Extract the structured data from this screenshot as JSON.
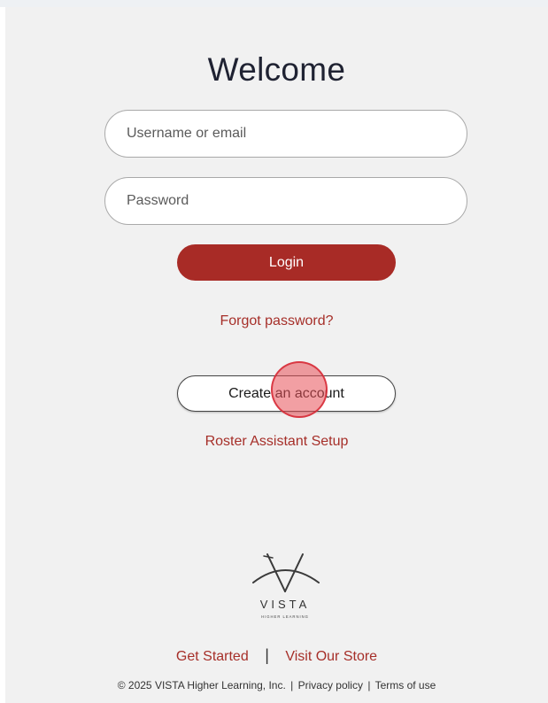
{
  "header": {
    "title": "Welcome"
  },
  "login_form": {
    "username_placeholder": "Username or email",
    "password_placeholder": "Password",
    "login_label": "Login",
    "forgot_label": "Forgot password?"
  },
  "account": {
    "create_label": "Create an account",
    "roster_label": "Roster Assistant Setup"
  },
  "logo": {
    "name": "VISTA",
    "tagline": "HIGHER LEARNING",
    "icon": "vista-logo-icon"
  },
  "footer": {
    "get_started": "Get Started",
    "separator": "|",
    "visit_store": "Visit Our Store",
    "copyright": "© 2025 VISTA Higher Learning, Inc.",
    "privacy": "Privacy policy",
    "terms": "Terms of use",
    "bar": "|"
  },
  "colors": {
    "accent": "#a82b26",
    "link": "#a62f29",
    "background": "#f1f1f1",
    "click_marker": "#e85058"
  }
}
